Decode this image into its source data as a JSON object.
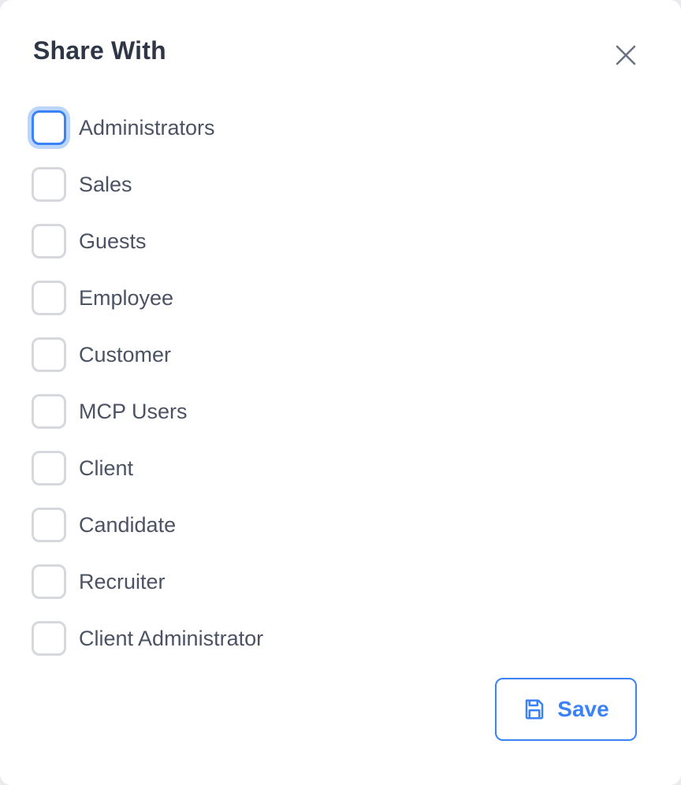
{
  "dialog": {
    "title": "Share With",
    "close_icon": "close-icon",
    "options": [
      {
        "label": "Administrators",
        "checked": false,
        "focused": true
      },
      {
        "label": "Sales",
        "checked": false
      },
      {
        "label": "Guests",
        "checked": false
      },
      {
        "label": "Employee",
        "checked": false
      },
      {
        "label": "Customer",
        "checked": false
      },
      {
        "label": "MCP Users",
        "checked": false
      },
      {
        "label": "Client",
        "checked": false
      },
      {
        "label": "Candidate",
        "checked": false
      },
      {
        "label": "Recruiter",
        "checked": false
      },
      {
        "label": "Client Administrator",
        "checked": false
      }
    ],
    "save": {
      "label": "Save",
      "icon": "floppy-disk-icon"
    }
  },
  "colors": {
    "accent": "#3b82f6",
    "title_text": "#2f3747",
    "label_text": "#4a5263",
    "checkbox_border": "#d6d8de",
    "focus_ring": "#bcd6fb"
  }
}
